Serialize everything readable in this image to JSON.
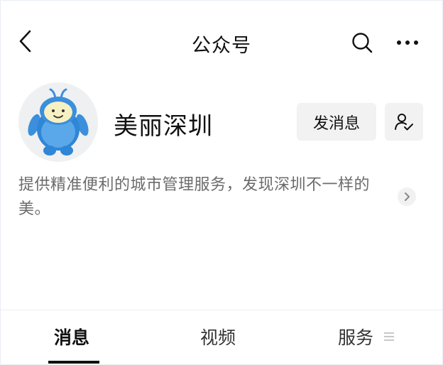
{
  "header": {
    "title": "公众号",
    "back_icon": "chevron-left-icon",
    "search_icon": "search-icon",
    "more_icon": "more-horizontal-icon"
  },
  "profile": {
    "name": "美丽深圳",
    "send_message_label": "发消息",
    "follow_icon": "person-check-icon",
    "description": "提供精准便利的城市管理服务，发现深圳不一样的美。"
  },
  "tabs": [
    {
      "label": "消息",
      "active": true
    },
    {
      "label": "视频",
      "active": false
    },
    {
      "label": "服务",
      "active": false
    }
  ],
  "colors": {
    "button_bg": "#f2f2f2",
    "text_primary": "#111111",
    "text_secondary": "#6b6b6b",
    "mascot_blue": "#3b8fdc"
  }
}
